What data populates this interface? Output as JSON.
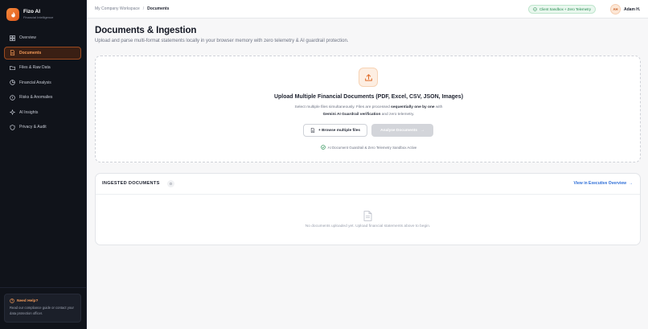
{
  "brand": {
    "name": "Fizo AI",
    "subtitle": "Financial Intelligence"
  },
  "sidebar": {
    "items": [
      {
        "label": "Overview",
        "icon": "grid-icon"
      },
      {
        "label": "Documents",
        "icon": "document-icon",
        "active": true
      },
      {
        "label": "Files & Raw Data",
        "icon": "folder-icon"
      },
      {
        "label": "Financial Analysis",
        "icon": "chart-icon"
      },
      {
        "label": "Risks & Anomalies",
        "icon": "alert-icon"
      },
      {
        "label": "AI Insights",
        "icon": "sparkle-icon"
      },
      {
        "label": "Privacy & Audit",
        "icon": "shield-icon"
      }
    ],
    "help": {
      "title": "Need Help?",
      "text": "Read our compliance guide or contact your data protection officer."
    }
  },
  "topbar": {
    "breadcrumb_root": "My Company Workspace",
    "breadcrumb_sep": "/",
    "breadcrumb_current": "Documents",
    "badge": "Client Sandbox + Zero Telemetry",
    "user_initials": "AH",
    "user_name": "Adam H."
  },
  "page": {
    "title": "Documents & Ingestion",
    "subtitle": "Upload and parse multi-format statements locally in your browser memory with zero telemetry & AI guardrail protection."
  },
  "upload": {
    "title": "Upload Multiple Financial Documents (PDF, Excel, CSV, JSON, Images)",
    "desc_part1": "Select multiple files simultaneously. Files are processed ",
    "desc_bold1": "sequentially one by one",
    "desc_part2": " with",
    "desc_bold2": "Gemini AI Guardrail verification",
    "desc_part3": " and zero telemetry.",
    "browse_label": "+ Browse multiple files",
    "analyze_label": "Analyse Documents",
    "analyze_arrow": "→",
    "guard_text": "AI Document Guardrail & Zero Telemetry Sandbox Active"
  },
  "docs": {
    "title": "INGESTED DOCUMENTS",
    "count": "0",
    "link_label": "View in Executive Overview",
    "link_arrow": "→",
    "empty_text": "No documents uploaded yet. Upload financial statements above to begin."
  },
  "colors": {
    "accent": "#f0803c",
    "sidebar_bg": "#10131a",
    "link": "#2f6fd8",
    "success": "#1f8a4c"
  }
}
